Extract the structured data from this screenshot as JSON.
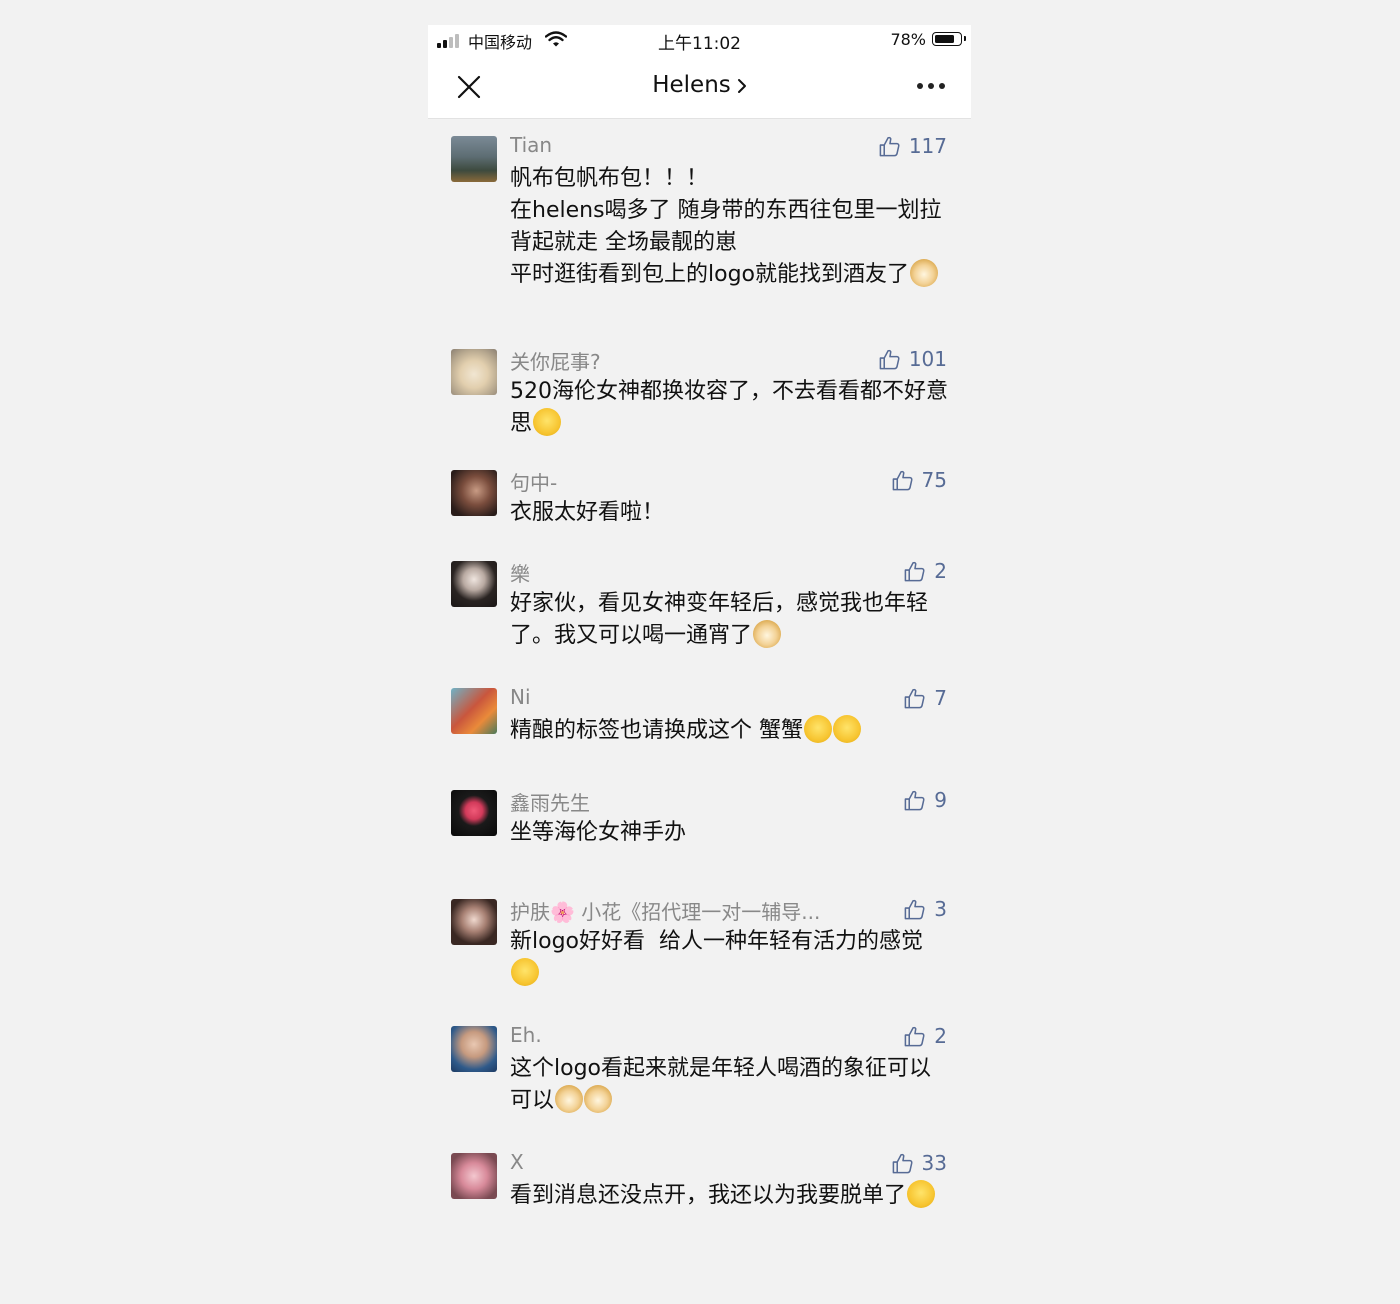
{
  "status_bar": {
    "carrier": "中国移动",
    "time": "上午11:02",
    "battery": "78%",
    "battery_level": 0.78
  },
  "nav": {
    "title": "Helens",
    "close_icon": "close-icon",
    "more_icon": "more-icon"
  },
  "colors": {
    "like_blue": "#576b95",
    "nickname_gray": "#888888",
    "text": "#111111",
    "background": "#f2f2f2"
  },
  "comments": [
    {
      "nickname": "Tian",
      "likes": "117",
      "text": "帆布包帆布包！！！\n在helens喝多了 随身带的东西往包里一划拉背起就走 全场最靓的崽\n平时逛街看到包上的logo就能找到酒友了",
      "emoji": [
        "doge-emoji"
      ]
    },
    {
      "nickname": "关你屁事?",
      "likes": "101",
      "text": "520海伦女神都换妆容了，不去看看都不好意思",
      "emoji": [
        "sunglasses-emoji"
      ]
    },
    {
      "nickname": "句中-",
      "likes": "75",
      "text": "衣服太好看啦！",
      "emoji": []
    },
    {
      "nickname": "樂",
      "likes": "2",
      "text": "好家伙，看见女神变年轻后，感觉我也年轻了。我又可以喝一通宵了",
      "emoji": [
        "doge-emoji"
      ]
    },
    {
      "nickname": "Ni",
      "likes": "7",
      "text": "精酿的标签也请换成这个 蟹蟹",
      "emoji": [
        "smirk-emoji",
        "smirk-emoji"
      ]
    },
    {
      "nickname": "鑫雨先生",
      "likes": "9",
      "text": "坐等海伦女神手办",
      "emoji": []
    },
    {
      "nickname": "护肤🌸 小花《招代理一对一辅导...",
      "likes": "3",
      "text": "新logo好好看  给人一种年轻有活力的感觉",
      "emoji": [
        "dazed-emoji"
      ]
    },
    {
      "nickname": "Eh.",
      "likes": "2",
      "text": "这个logo看起来就是年轻人喝酒的象征可以可以",
      "emoji": [
        "doge-emoji",
        "doge-emoji"
      ]
    },
    {
      "nickname": "X",
      "likes": "33",
      "text": "看到消息还没点开，我还以为我要脱单了",
      "emoji": [
        "smile-emoji"
      ]
    }
  ]
}
